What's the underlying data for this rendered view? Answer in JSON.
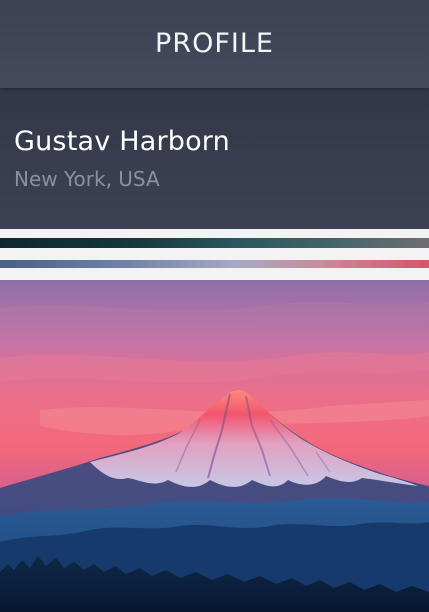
{
  "header": {
    "title": "PROFILE"
  },
  "profile": {
    "name": "Gustav Harborn",
    "location": "New York, USA"
  },
  "colors": {
    "header_bg": "#3f4658",
    "card_bg": "#373c4e",
    "name_text": "#ffffff",
    "location_text": "#8a90a3"
  }
}
